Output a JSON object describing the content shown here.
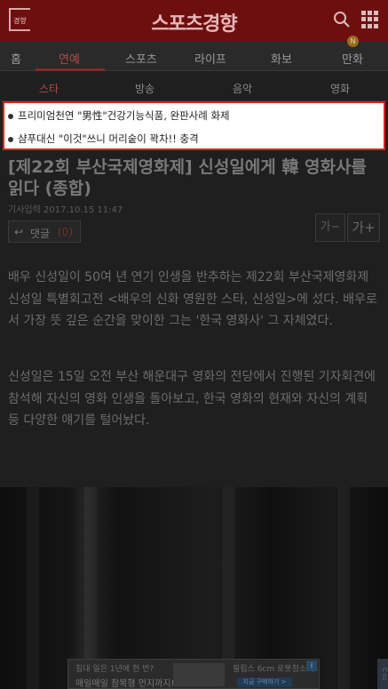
{
  "header": {
    "logo_small": "경향",
    "brand": "스포츠경향"
  },
  "mainnav": {
    "items": [
      "홈",
      "연예",
      "스포츠",
      "라이프",
      "화보",
      "만화"
    ],
    "active": "연예",
    "badge": "N"
  },
  "subnav": {
    "items": [
      "스타",
      "방송",
      "음악",
      "영화"
    ],
    "active": "스타"
  },
  "promo": {
    "items": [
      "프리미엄천연 \"男性\"건강기능식품, 완판사례 화제",
      "샴푸대신 \"이것\"쓰니 머리숱이 꽉차!! 충격"
    ]
  },
  "article": {
    "title": "[제22회 부산국제영화제] 신성일에게 韓 영화사를 읽다 (종합)",
    "date": "기사입력 2017.10.15 11:47",
    "comment_label": "댓글",
    "comment_count": "(0)",
    "font_small": "가−",
    "font_large": "가+",
    "paragraphs": [
      "배우 신성일이 50여 년 연기 인생을 반추하는 제22회 부산국제영화제 신성일 특별회고전 <배우의 신화 영원한 스타, 신성일>에 섰다. 배우로서 가장 뜻 깊은 순간을 맞이한 그는 '한국 영화사' 그 자체였다.",
      "신성일은 15일 오전 부산 해운대구 영화의 전당에서 진행된 기자회견에 참석해 자신의 영화 인생을 돌아보고, 한국 영화의 현재와 자신의 계획 등 다양한 얘기를 털어놨다."
    ]
  },
  "ad": {
    "left_line1": "침대 일은 1년에 한 번?",
    "left_line2": "매일매일 참복형 먼지까지!",
    "right_line1": "필립스 6cm 로봇청소기",
    "cta": "지금 구매하기 >",
    "badge": "i",
    "side": "C cc"
  }
}
